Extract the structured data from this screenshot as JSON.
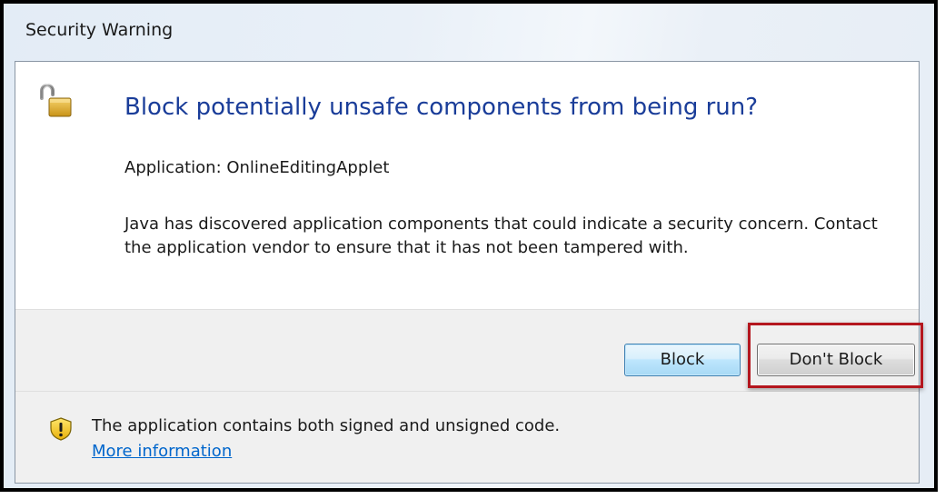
{
  "window": {
    "title": "Security Warning"
  },
  "dialog": {
    "main_instruction": "Block potentially unsafe components from being run?",
    "application_line": "Application: OnlineEditingApplet",
    "body": "Java has discovered application components that could indicate a security concern. Contact the application vendor to ensure that it has not been tampered with.",
    "icon": "unlocked-padlock-icon",
    "accent_color": "#1a3d99"
  },
  "buttons": {
    "block_label": "Block",
    "dont_block_label": "Don't Block"
  },
  "footer": {
    "icon": "warning-shield-icon",
    "message": "The application contains both signed and unsigned code.",
    "link_label": "More information",
    "link_color": "#0066cc"
  },
  "annotation": {
    "highlight_color": "#b4161e"
  }
}
